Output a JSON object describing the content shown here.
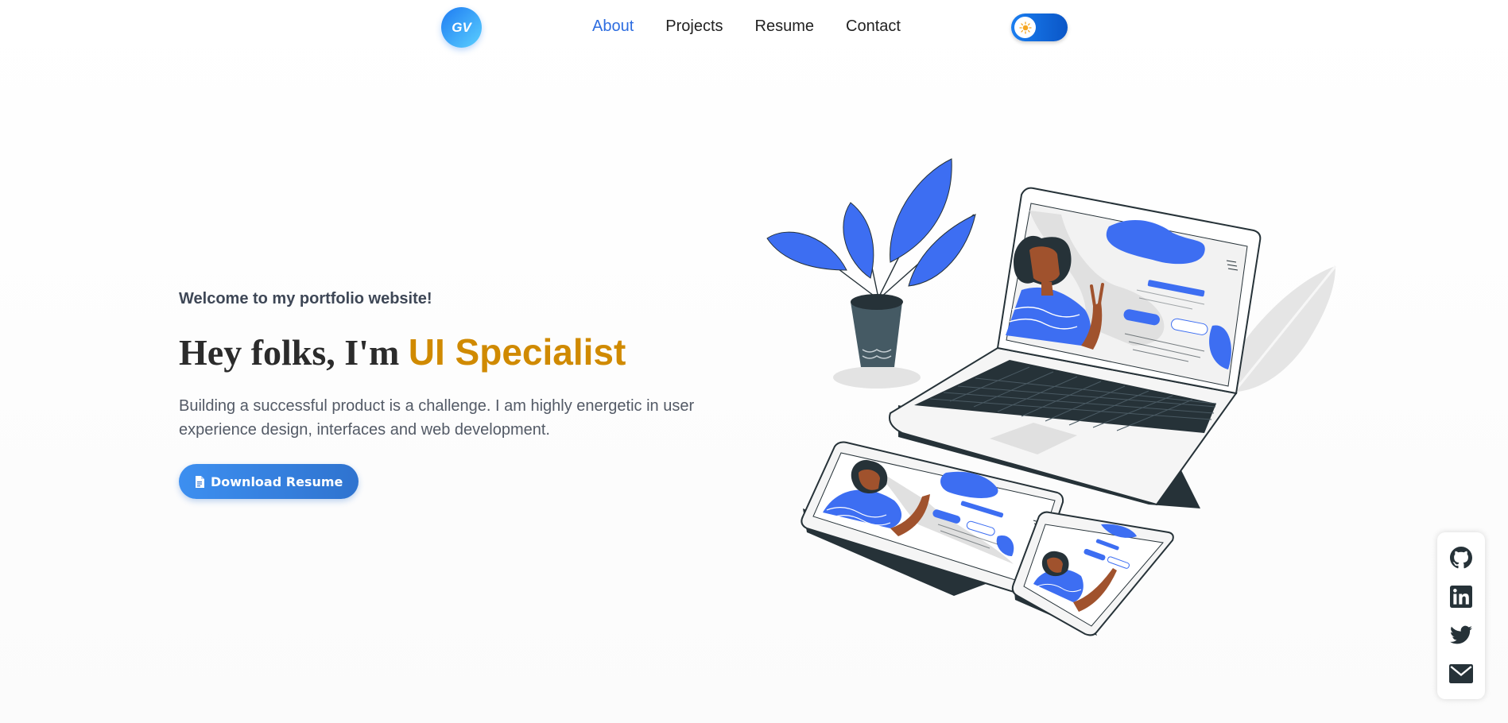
{
  "nav": {
    "logo_text": "GV",
    "links": [
      {
        "label": "About",
        "active": true
      },
      {
        "label": "Projects",
        "active": false
      },
      {
        "label": "Resume",
        "active": false
      },
      {
        "label": "Contact",
        "active": false
      }
    ],
    "theme_toggle": {
      "icon": "sun-icon"
    }
  },
  "hero": {
    "welcome": "Welcome to my portfolio website!",
    "headline_prefix": "Hey folks, I'm ",
    "headline_highlight": "UI Specialist",
    "lead": "Building a successful product is a challenge. I am highly energetic in user experience design, interfaces and web development.",
    "button_label": "Download Resume",
    "button_icon": "document-icon"
  },
  "social": {
    "items": [
      {
        "name": "github-icon"
      },
      {
        "name": "linkedin-icon"
      },
      {
        "name": "twitter-icon"
      },
      {
        "name": "envelope-icon"
      }
    ]
  },
  "colors": {
    "accent": "#2d6de0",
    "highlight": "#d08a00",
    "illustration_blue": "#3d6ef2",
    "dark": "#263238"
  }
}
